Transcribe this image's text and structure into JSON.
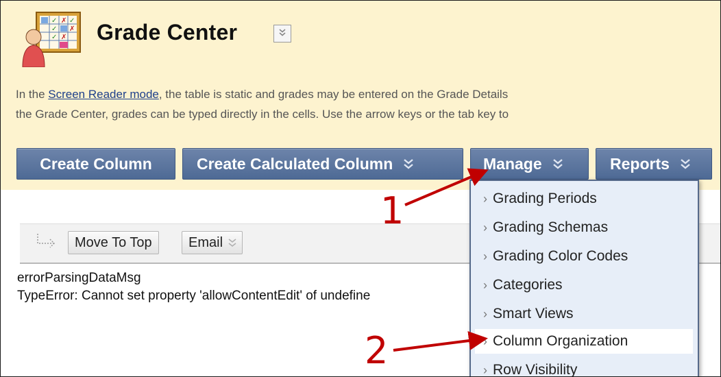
{
  "header": {
    "title": "Grade Center",
    "info_line1_prefix": "In the ",
    "info_link": "Screen Reader mode",
    "info_line1_suffix": ", the table is static and grades may be entered on the Grade Details",
    "info_line2": "the Grade Center, grades can be typed directly in the cells. Use the arrow keys or the tab key to"
  },
  "action_bar": {
    "create_column": "Create Column",
    "create_calculated_column": "Create Calculated Column",
    "manage": "Manage",
    "reports": "Reports"
  },
  "table_toolbar": {
    "move_to_top": "Move To Top",
    "email": "Email"
  },
  "error": {
    "line1": "errorParsingDataMsg",
    "line2": "TypeError: Cannot set property 'allowContentEdit' of undefine"
  },
  "manage_menu": {
    "items": [
      {
        "label": "Grading Periods"
      },
      {
        "label": "Grading Schemas"
      },
      {
        "label": "Grading Color Codes"
      },
      {
        "label": "Categories"
      },
      {
        "label": "Smart Views"
      },
      {
        "label": "Column Organization",
        "highlighted": true
      },
      {
        "label": "Row Visibility"
      }
    ]
  },
  "annotations": {
    "step1": "1",
    "step2": "2",
    "color": "#c00000"
  },
  "colors": {
    "header_bg": "#fdf3cf",
    "button_blue": "#5a7299",
    "menu_bg": "#e7eef8"
  }
}
